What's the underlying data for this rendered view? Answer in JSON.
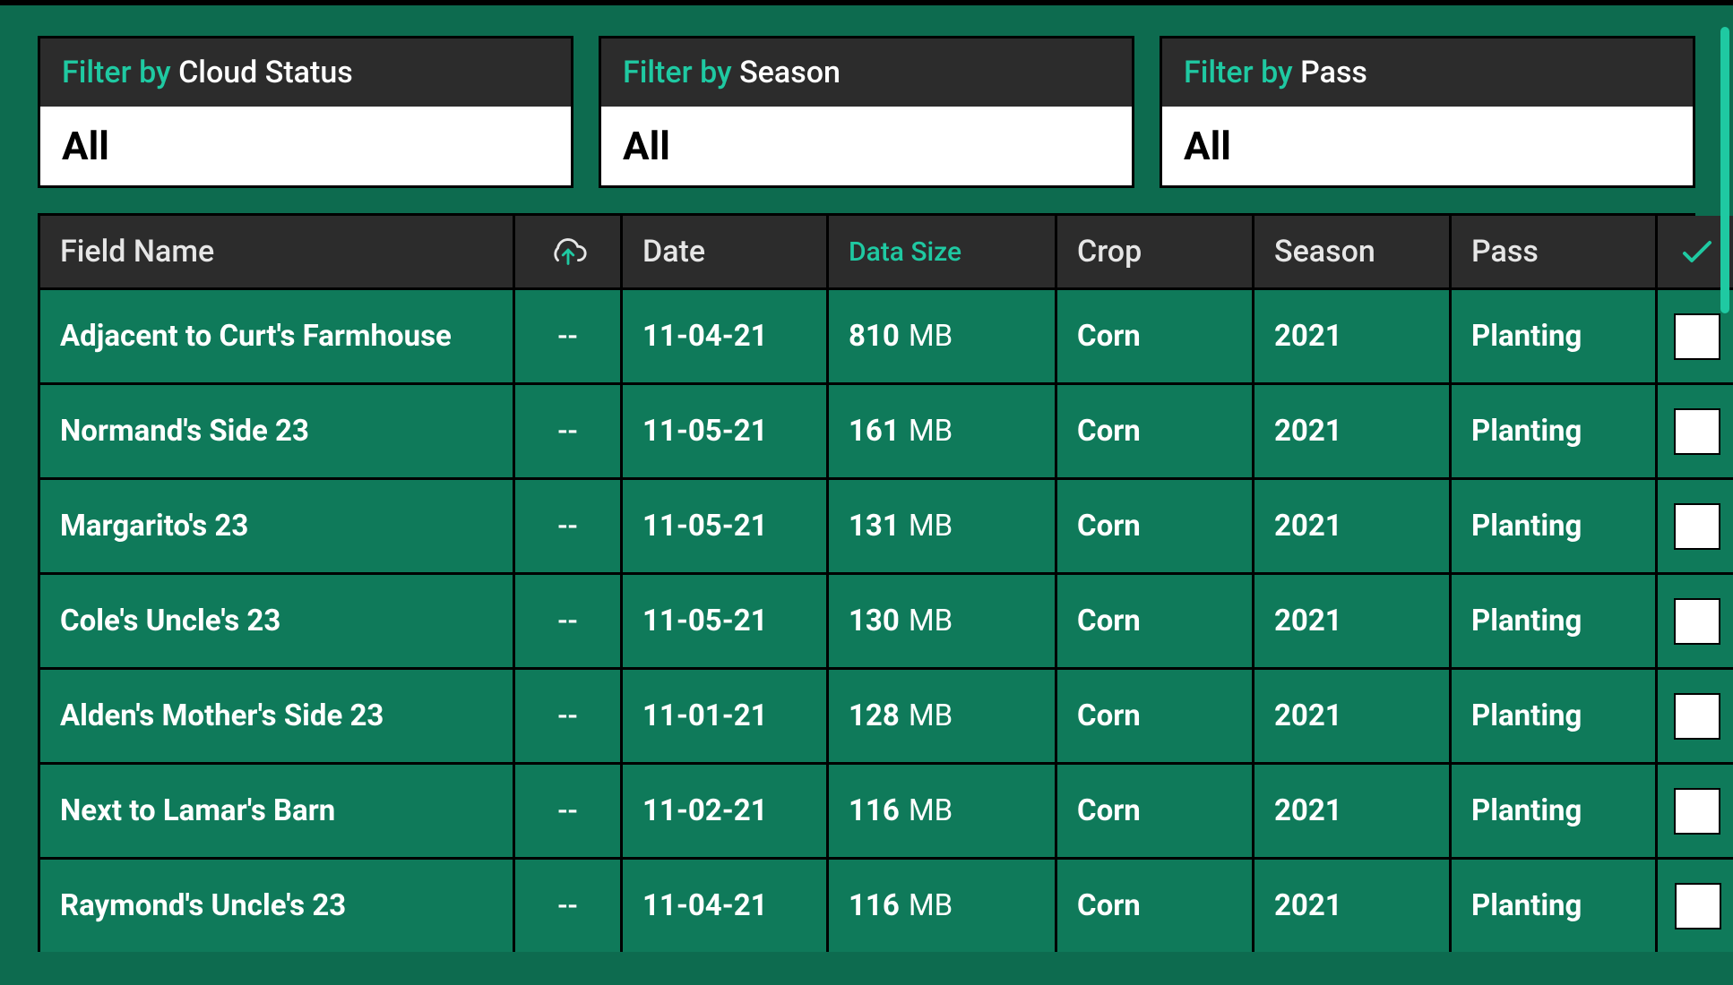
{
  "filters": [
    {
      "prefix": "Filter by",
      "suffix": "Cloud Status",
      "value": "All"
    },
    {
      "prefix": "Filter by",
      "suffix": "Season",
      "value": "All"
    },
    {
      "prefix": "Filter by",
      "suffix": "Pass",
      "value": "All"
    }
  ],
  "columns": {
    "field_name": "Field Name",
    "cloud": "cloud-upload-icon",
    "date": "Date",
    "data_size": "Data Size",
    "crop": "Crop",
    "season": "Season",
    "pass": "Pass",
    "select_all": "check-icon"
  },
  "sort": {
    "column": "data_size",
    "direction": "desc"
  },
  "rows": [
    {
      "field_name": "Adjacent to Curt's Farmhouse",
      "cloud": "--",
      "date": "11-04-21",
      "size_value": "810",
      "size_unit": "MB",
      "crop": "Corn",
      "season": "2021",
      "pass": "Planting",
      "checked": false
    },
    {
      "field_name": "Normand's Side 23",
      "cloud": "--",
      "date": "11-05-21",
      "size_value": "161",
      "size_unit": "MB",
      "crop": "Corn",
      "season": "2021",
      "pass": "Planting",
      "checked": false
    },
    {
      "field_name": "Margarito's 23",
      "cloud": "--",
      "date": "11-05-21",
      "size_value": "131",
      "size_unit": "MB",
      "crop": "Corn",
      "season": "2021",
      "pass": "Planting",
      "checked": false
    },
    {
      "field_name": "Cole's Uncle's 23",
      "cloud": "--",
      "date": "11-05-21",
      "size_value": "130",
      "size_unit": "MB",
      "crop": "Corn",
      "season": "2021",
      "pass": "Planting",
      "checked": false
    },
    {
      "field_name": "Alden's Mother's Side 23",
      "cloud": "--",
      "date": "11-01-21",
      "size_value": "128",
      "size_unit": "MB",
      "crop": "Corn",
      "season": "2021",
      "pass": "Planting",
      "checked": false
    },
    {
      "field_name": "Next to Lamar's Barn",
      "cloud": "--",
      "date": "11-02-21",
      "size_value": "116",
      "size_unit": "MB",
      "crop": "Corn",
      "season": "2021",
      "pass": "Planting",
      "checked": false
    },
    {
      "field_name": "Raymond's Uncle's 23",
      "cloud": "--",
      "date": "11-04-21",
      "size_value": "116",
      "size_unit": "MB",
      "crop": "Corn",
      "season": "2021",
      "pass": "Planting",
      "checked": false
    }
  ],
  "colors": {
    "accent": "#1fc9a2",
    "bg": "#0d6b4f",
    "row": "#0f7a5a",
    "header": "#2c2c2c"
  }
}
